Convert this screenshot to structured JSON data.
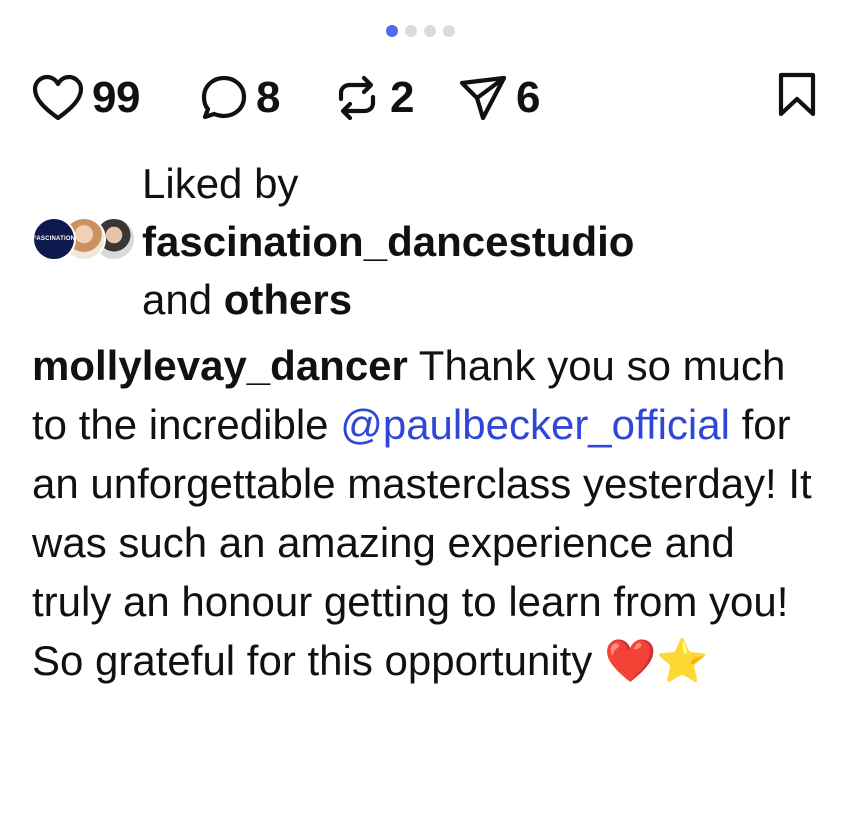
{
  "carousel": {
    "dot_count": 4,
    "active_index": 0,
    "active_color": "#4f6bed",
    "inactive_color": "#d9dbe0"
  },
  "actions": {
    "likes": "99",
    "comments": "8",
    "reposts": "2",
    "shares": "6",
    "icons": [
      "heart-icon",
      "comment-icon",
      "repost-icon",
      "send-icon",
      "bookmark-icon"
    ]
  },
  "liked_by": {
    "prefix": "Liked by",
    "account": "fascination_dancestudio",
    "conjunction": "and",
    "others": "others",
    "avatar1_text": "FASCINATION"
  },
  "caption": {
    "username": "mollylevay_dancer",
    "text_before": " Thank you so much to the incredible ",
    "mention": "@paulbecker_official",
    "text_after": " for an unforgettable masterclass yesterday! It was such an amazing experience and truly an honour getting to learn from you! So grateful for this opportunity ",
    "emoji_heart": "❤️",
    "emoji_star": "⭐"
  },
  "colors": {
    "text": "#111111",
    "mention": "#2f47d6"
  }
}
